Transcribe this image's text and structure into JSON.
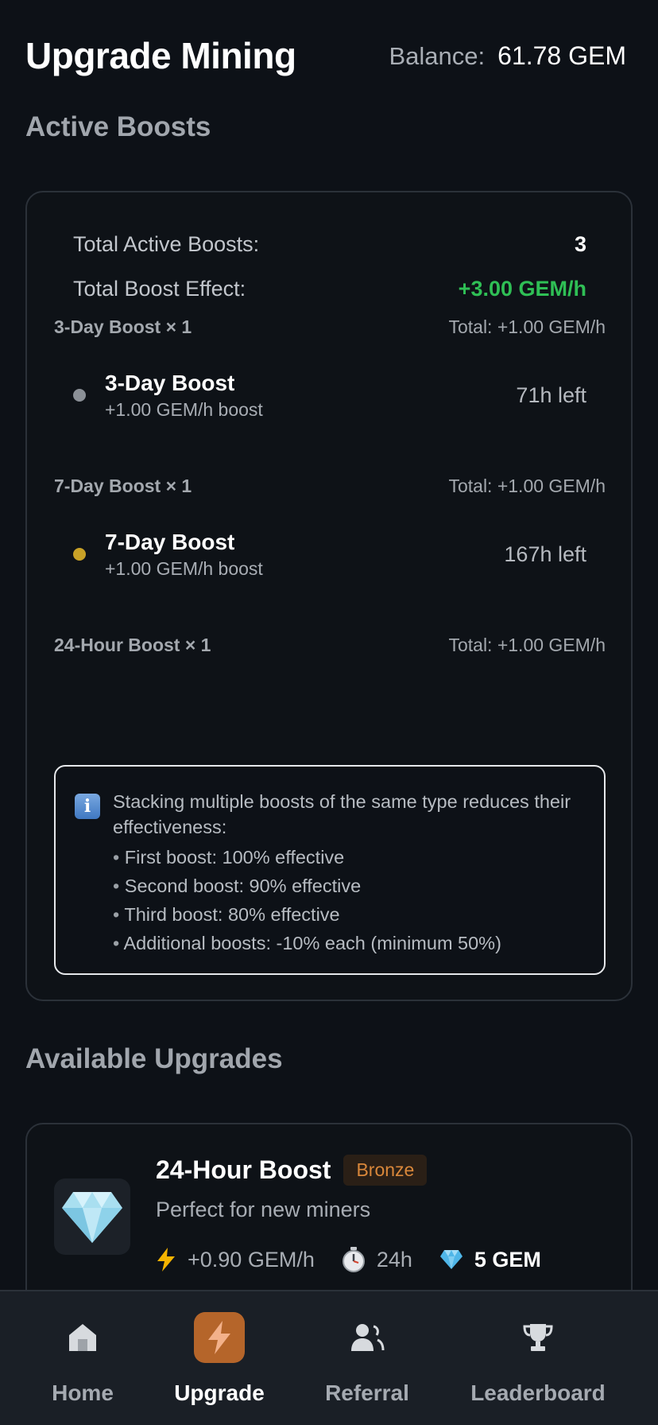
{
  "header": {
    "title": "Upgrade Mining",
    "balance_label": "Balance:",
    "balance_value": "61.78 GEM"
  },
  "active_boosts": {
    "section_title": "Active Boosts",
    "summary": {
      "total_active_label": "Total Active Boosts:",
      "total_active_value": "3",
      "total_effect_label": "Total Boost Effect:",
      "total_effect_value": "+3.00 GEM/h",
      "effect_color": "#2fbf55"
    },
    "groups": [
      {
        "title": "3-Day Boost × 1",
        "total": "Total: +1.00 GEM/h",
        "item": {
          "name": "3-Day Boost",
          "sub": "+1.00 GEM/h boost",
          "time_left": "71h left",
          "dot_color": "#8b9097"
        }
      },
      {
        "title": "7-Day Boost × 1",
        "total": "Total: +1.00 GEM/h",
        "item": {
          "name": "7-Day Boost",
          "sub": "+1.00 GEM/h boost",
          "time_left": "167h left",
          "dot_color": "#c9a227"
        }
      },
      {
        "title": "24-Hour Boost × 1",
        "total": "Total: +1.00 GEM/h"
      }
    ],
    "info": {
      "icon": "info-icon",
      "intro": "Stacking multiple boosts of the same type reduces their effectiveness:",
      "points": [
        "First boost: 100% effective",
        "Second boost: 90% effective",
        "Third boost: 80% effective",
        "Additional boosts: -10% each (minimum 50%)"
      ]
    }
  },
  "available_upgrades": {
    "section_title": "Available Upgrades",
    "items": [
      {
        "icon": "diamond-icon",
        "name": "24-Hour Boost",
        "tier": "Bronze",
        "description": "Perfect for new miners",
        "rate": "+0.90 GEM/h",
        "duration": "24h",
        "price": "5 GEM"
      }
    ]
  },
  "nav": {
    "items": [
      {
        "label": "Home",
        "icon": "home-icon",
        "active": false
      },
      {
        "label": "Upgrade",
        "icon": "lightning-icon",
        "active": true
      },
      {
        "label": "Referral",
        "icon": "users-icon",
        "active": false
      },
      {
        "label": "Leaderboard",
        "icon": "trophy-icon",
        "active": false
      }
    ]
  }
}
